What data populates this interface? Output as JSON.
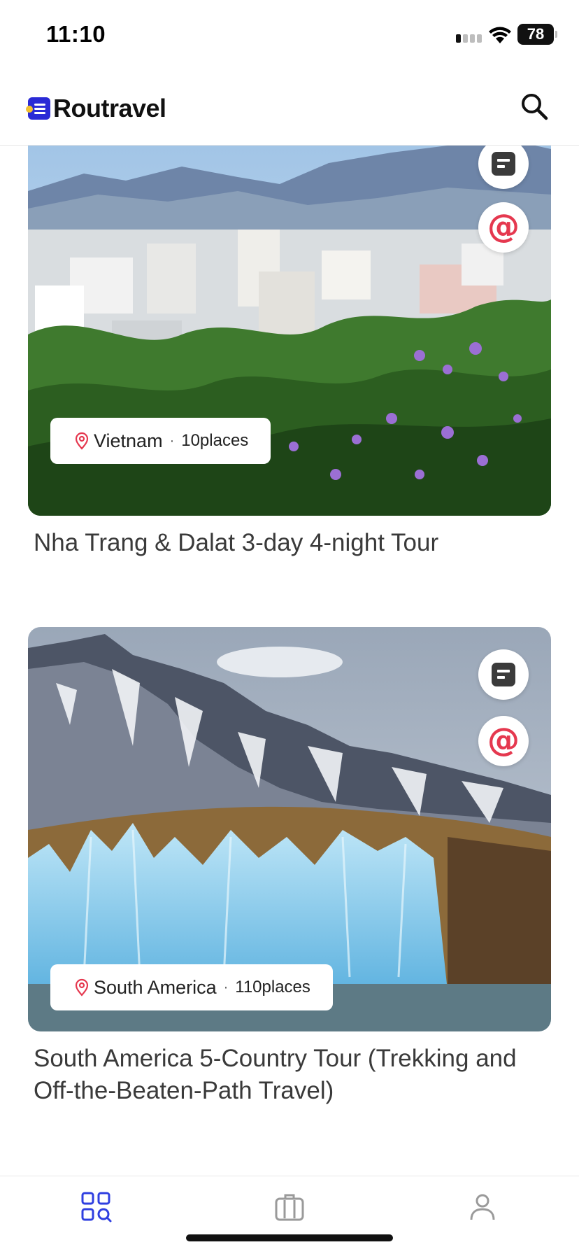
{
  "status_bar": {
    "time": "11:10",
    "battery": "78"
  },
  "header": {
    "brand": "Routravel",
    "search_icon": "search-icon"
  },
  "tours": [
    {
      "country": "Vietnam",
      "places": "10places",
      "title": "Nha Trang & Dalat 3-day 4-night Tour",
      "actions": [
        "document-icon",
        "mention-icon"
      ]
    },
    {
      "country": "South America",
      "places": "110places",
      "title": "South America 5-Country Tour (Trekking and Off-the-Beaten-Path Travel)",
      "actions": [
        "document-icon",
        "mention-icon"
      ]
    }
  ],
  "icons": {
    "at_symbol": "@",
    "dot": "·"
  },
  "bottom_nav": {
    "items": [
      "grid-search-icon",
      "luggage-icon",
      "profile-icon"
    ],
    "active_color": "#2f3fe0",
    "inactive_color": "#9a9a9a"
  },
  "colors": {
    "brand": "#2a2ad6",
    "accent_red": "#e5384f"
  }
}
